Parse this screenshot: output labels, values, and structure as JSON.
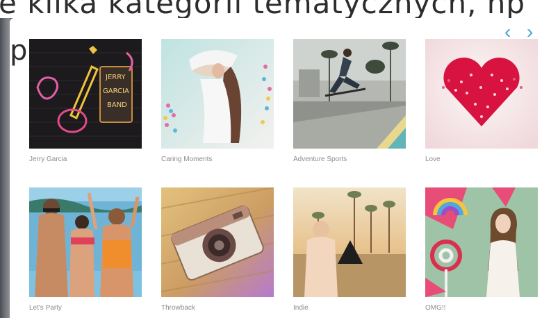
{
  "background_text": {
    "top_line": "e kilka kategorii tematycznych, np",
    "side_letter": "p"
  },
  "carousel": {
    "prev_icon": "chevron-left-icon",
    "next_icon": "chevron-right-icon",
    "prev_glyph": "‹",
    "next_glyph": "›",
    "accent": "#4aa6d6"
  },
  "categories": [
    {
      "label": "Jerry Garcia"
    },
    {
      "label": "Caring Moments"
    },
    {
      "label": "Adventure Sports"
    },
    {
      "label": "Love"
    },
    {
      "label": "Let's Party"
    },
    {
      "label": "Throwback"
    },
    {
      "label": "Indie"
    },
    {
      "label": "OMG!!"
    }
  ]
}
